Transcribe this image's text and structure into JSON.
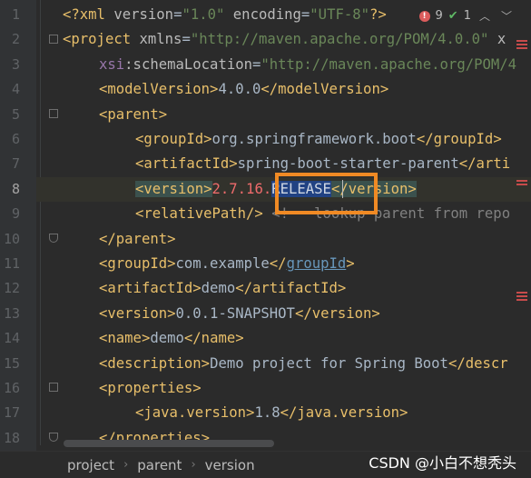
{
  "editor": {
    "line_numbers": [
      "1",
      "2",
      "3",
      "4",
      "5",
      "6",
      "7",
      "8",
      "9",
      "10",
      "11",
      "12",
      "13",
      "14",
      "15",
      "16",
      "17",
      "18"
    ],
    "lines": {
      "l1": {
        "a": "<?xml ",
        "b": "version",
        "c": "=",
        "d": "\"1.0\"",
        "e": " ",
        "f": "encoding",
        "g": "=",
        "h": "\"UTF-8\"",
        "i": "?>"
      },
      "l2": {
        "a": "<project ",
        "b": "xmlns",
        "c": "=",
        "d": "\"http://maven.apache.org/POM/4.0.0\"",
        "e": " x"
      },
      "l3": {
        "a": "xsi",
        "b": ":schemaLocation",
        "c": "=",
        "d": "\"http://maven.apache.org/POM/4"
      },
      "l4": {
        "a": "<modelVersion>",
        "b": "4.0.0",
        "c": "</modelVersion>"
      },
      "l5": {
        "a": "<parent>"
      },
      "l6": {
        "a": "<groupId>",
        "b": "org.springframework.boot",
        "c": "</groupId>"
      },
      "l7": {
        "a": "<artifactId>",
        "b": "spring-boot-starter-parent",
        "c": "</arti"
      },
      "l8": {
        "a": "<version>",
        "b": "2.7.16.",
        "c": "RELEASE",
        "d": "</version>"
      },
      "l9": {
        "a": "<relativePath/>",
        "b": " <!-- lookup parent from repo"
      },
      "l10": {
        "a": "</parent>"
      },
      "l11": {
        "a": "<groupId>",
        "b": "com.example",
        "c": "</",
        "d": "groupId",
        "e": ">"
      },
      "l12": {
        "a": "<artifactId>",
        "b": "demo",
        "c": "</artifactId>"
      },
      "l13": {
        "a": "<version>",
        "b": "0.0.1-SNAPSHOT",
        "c": "</version>"
      },
      "l14": {
        "a": "<name>",
        "b": "demo",
        "c": "</name>"
      },
      "l15": {
        "a": "<description>",
        "b": "Demo project for Spring Boot",
        "c": "</descr"
      },
      "l16": {
        "a": "<properties>"
      },
      "l17": {
        "a": "<java.version>",
        "b": "1.8",
        "c": "</java.version>"
      },
      "l18": {
        "a": "</properties>"
      }
    },
    "inspection": {
      "errors": "9",
      "ok": "1"
    }
  },
  "breadcrumb": [
    "project",
    "parent",
    "version"
  ],
  "watermark": "CSDN @小白不想秃头",
  "colors": {
    "background": "#2b2b2b",
    "tag": "#e8bf6a",
    "string": "#6a8759",
    "error": "#ed6b6b",
    "highlight_box": "#f08a24"
  }
}
